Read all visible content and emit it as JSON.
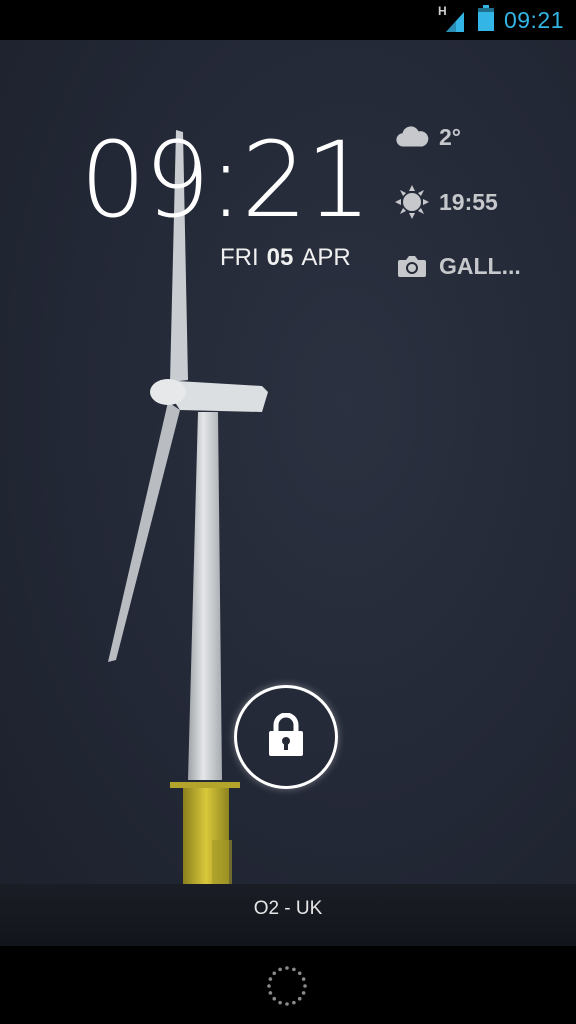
{
  "status_bar": {
    "network_type": "H",
    "time": "09:21",
    "accent_color": "#33b5e5",
    "icons": [
      "signal-icon",
      "battery-icon"
    ]
  },
  "lockscreen": {
    "clock": "09:21",
    "date": {
      "weekday": "FRI",
      "day": "05",
      "month": "APR"
    },
    "widgets": [
      {
        "icon": "cloud-icon",
        "text": "2°"
      },
      {
        "icon": "sun-icon",
        "text": "19:55"
      },
      {
        "icon": "camera-icon",
        "text": "GALL..."
      }
    ],
    "lock_icon": "lock-icon",
    "carrier": "O2 - UK"
  },
  "nav_bar": {
    "icon": "dotted-ring-icon"
  }
}
